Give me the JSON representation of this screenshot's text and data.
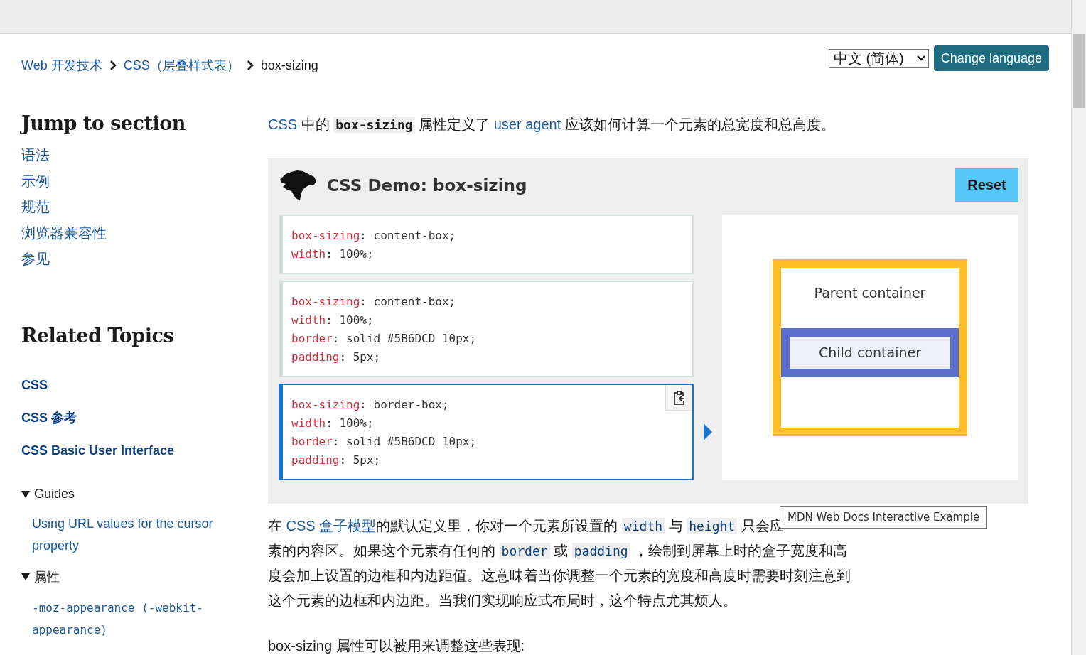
{
  "breadcrumb": [
    {
      "text": "Web 开发技术",
      "kind": "link"
    },
    {
      "text": "CSS（层叠样式表）",
      "kind": "link"
    },
    {
      "text": "box-sizing",
      "kind": "current"
    }
  ],
  "language": {
    "value": "中文 (简体)",
    "button": "Change language"
  },
  "jump_to_section": {
    "title": "Jump to section",
    "items": [
      "语法",
      "示例",
      "规范",
      "浏览器兼容性",
      "参见"
    ]
  },
  "related_topics": {
    "title": "Related Topics",
    "links": [
      "CSS",
      "CSS 参考",
      "CSS Basic User Interface"
    ],
    "groups": [
      {
        "label": "Guides",
        "expanded": true,
        "items": [
          {
            "text": "Using URL values for the cursor property",
            "kind": "text"
          }
        ]
      },
      {
        "label": "属性",
        "expanded": true,
        "items": [
          {
            "text": "-moz-appearance (-webkit-appearance)",
            "kind": "code"
          }
        ]
      }
    ]
  },
  "intro": [
    {
      "kind": "link",
      "text": "CSS"
    },
    {
      "kind": "text",
      "text": " 中的 "
    },
    {
      "kind": "code",
      "text": "box-sizing"
    },
    {
      "kind": "text",
      "text": " 属性定义了 "
    },
    {
      "kind": "link",
      "text": "user agent"
    },
    {
      "kind": "text",
      "text": " 应该如何计算一个元素的总宽度和总高度。"
    }
  ],
  "demo": {
    "title": "CSS Demo: box-sizing",
    "reset": "Reset",
    "examples": [
      {
        "selected": false,
        "lines": [
          {
            "property": "box-sizing",
            "rest": ": content-box;"
          },
          {
            "property": "width",
            "rest": ": 100%;"
          }
        ]
      },
      {
        "selected": false,
        "lines": [
          {
            "property": "box-sizing",
            "rest": ": content-box;"
          },
          {
            "property": "width",
            "rest": ": 100%;"
          },
          {
            "property": "border",
            "rest": ": solid #5B6DCD 10px;"
          },
          {
            "property": "padding",
            "rest": ": 5px;"
          }
        ]
      },
      {
        "selected": true,
        "lines": [
          {
            "property": "box-sizing",
            "rest": ": border-box;"
          },
          {
            "property": "width",
            "rest": ": 100%;"
          },
          {
            "property": "border",
            "rest": ": solid #5B6DCD 10px;"
          },
          {
            "property": "padding",
            "rest": ": 5px;"
          }
        ]
      }
    ],
    "output": {
      "parent": "Parent container",
      "child": "Child container"
    }
  },
  "tooltip": "MDN Web Docs Interactive Example",
  "paragraph": [
    [
      {
        "kind": "text",
        "text": "在 "
      },
      {
        "kind": "link",
        "text": "CSS 盒子模型"
      },
      {
        "kind": "text",
        "text": "的默认定义里，你对一个元素所设置的 "
      },
      {
        "kind": "code",
        "text": "width"
      },
      {
        "kind": "text",
        "text": " 与 "
      },
      {
        "kind": "code",
        "text": "height"
      },
      {
        "kind": "text",
        "text": " 只会应"
      }
    ],
    [
      {
        "kind": "text",
        "text": "素的内容区。如果这个元素有任何的 "
      },
      {
        "kind": "code",
        "text": "border"
      },
      {
        "kind": "text",
        "text": " 或 "
      },
      {
        "kind": "code",
        "text": "padding"
      },
      {
        "kind": "text",
        "text": " ，绘制到屏幕上时的盒子宽度和高"
      }
    ],
    [
      {
        "kind": "text",
        "text": "度会加上设置的边框和内边距值。这意味着当你调整一个元素的宽度和高度时需要时刻注意到"
      }
    ],
    [
      {
        "kind": "text",
        "text": "这个元素的边框和内边距。当我们实现响应式布局时，这个特点尤其烦人。"
      }
    ]
  ],
  "last_paragraph": "box-sizing 属性可以被用来调整这些表现:"
}
